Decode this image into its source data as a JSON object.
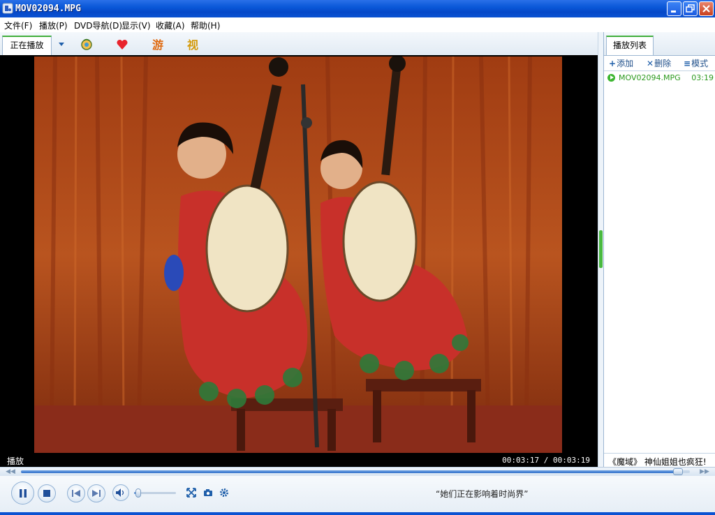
{
  "window": {
    "title": "MOV02094.MPG",
    "icons": {
      "app": "player-app-icon",
      "min": "minimize-icon",
      "max": "restore-icon",
      "close": "close-icon"
    }
  },
  "menu": [
    {
      "label": "文件(F)",
      "name": "menu-file"
    },
    {
      "label": "播放(P)",
      "name": "menu-play"
    },
    {
      "label": "DVD导航(D)",
      "name": "menu-dvd"
    },
    {
      "label": "显示(V)",
      "name": "menu-view"
    },
    {
      "label": "收藏(A)",
      "name": "menu-favorites"
    },
    {
      "label": "帮助(H)",
      "name": "menu-help"
    }
  ],
  "tabs": {
    "now_playing": "正在播放",
    "icons": [
      "dropdown-arrow-icon",
      "globe-music-icon",
      "heart-icon",
      "game-icon",
      "video-icon"
    ],
    "icon_labels": {
      "game": "游",
      "video": "视"
    }
  },
  "status": {
    "state": "播放",
    "time": "00:03:17 / 00:03:19"
  },
  "playlist": {
    "tab_label": "播放列表",
    "add": "添加",
    "delete": "删除",
    "mode": "模式",
    "items": [
      {
        "name": "MOV02094.MPG",
        "duration": "03:19"
      }
    ],
    "news": "《魔域》 神仙姐姐也疯狂!"
  },
  "progress": {
    "position": 0.99
  },
  "volume": {
    "level": 0.1
  },
  "marquee": "“她们正在影响着时尚界”",
  "colors": {
    "title_bar": "#0a58d8",
    "accent_green": "#3fae3b",
    "link_blue": "#1f5faa"
  }
}
